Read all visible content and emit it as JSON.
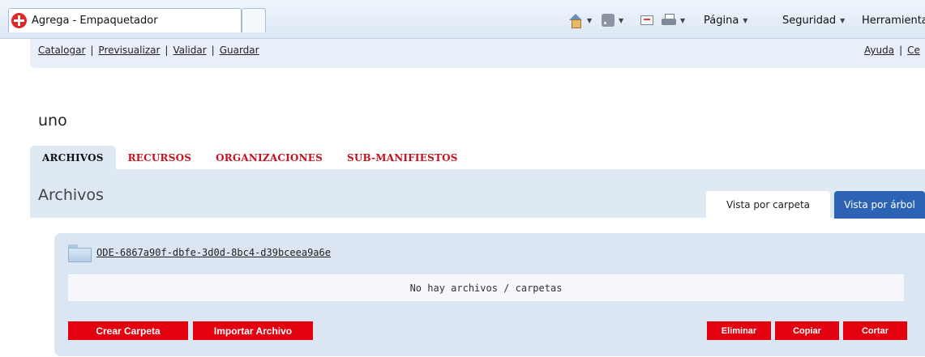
{
  "browser": {
    "tab_title": "Agrega - Empaquetador",
    "commands": {
      "page_label": "Página",
      "security_label": "Seguridad",
      "tools_label": "Herramientas"
    }
  },
  "topnav": {
    "left_links": [
      "Catalogar",
      "Previsualizar",
      "Validar",
      "Guardar"
    ],
    "separator": "|",
    "right_links": [
      "Ayuda",
      "Ce"
    ]
  },
  "ode_name": "uno",
  "tabs": [
    {
      "label": "ARCHIVOS",
      "active": true
    },
    {
      "label": "RECURSOS",
      "active": false
    },
    {
      "label": "ORGANIZACIONES",
      "active": false
    },
    {
      "label": "SUB-MANIFIESTOS",
      "active": false
    }
  ],
  "section_title": "Archivos",
  "view_tabs": {
    "folder_view": "Vista por carpeta",
    "tree_view": "Vista por árbol"
  },
  "folder": {
    "name": "ODE-6867a90f-dbfe-3d0d-8bc4-d39bceea9a6e",
    "empty_message": "No hay archivos / carpetas"
  },
  "buttons": {
    "create_folder": "Crear Carpeta",
    "import_file": "Importar Archivo",
    "delete": "Eliminar",
    "copy": "Copiar",
    "cut": "Cortar"
  },
  "colors": {
    "accent_red": "#e3000f",
    "tab_red": "#c4121e",
    "panel_blue": "#dfe9f4",
    "tree_tab_blue": "#2d63b5"
  }
}
